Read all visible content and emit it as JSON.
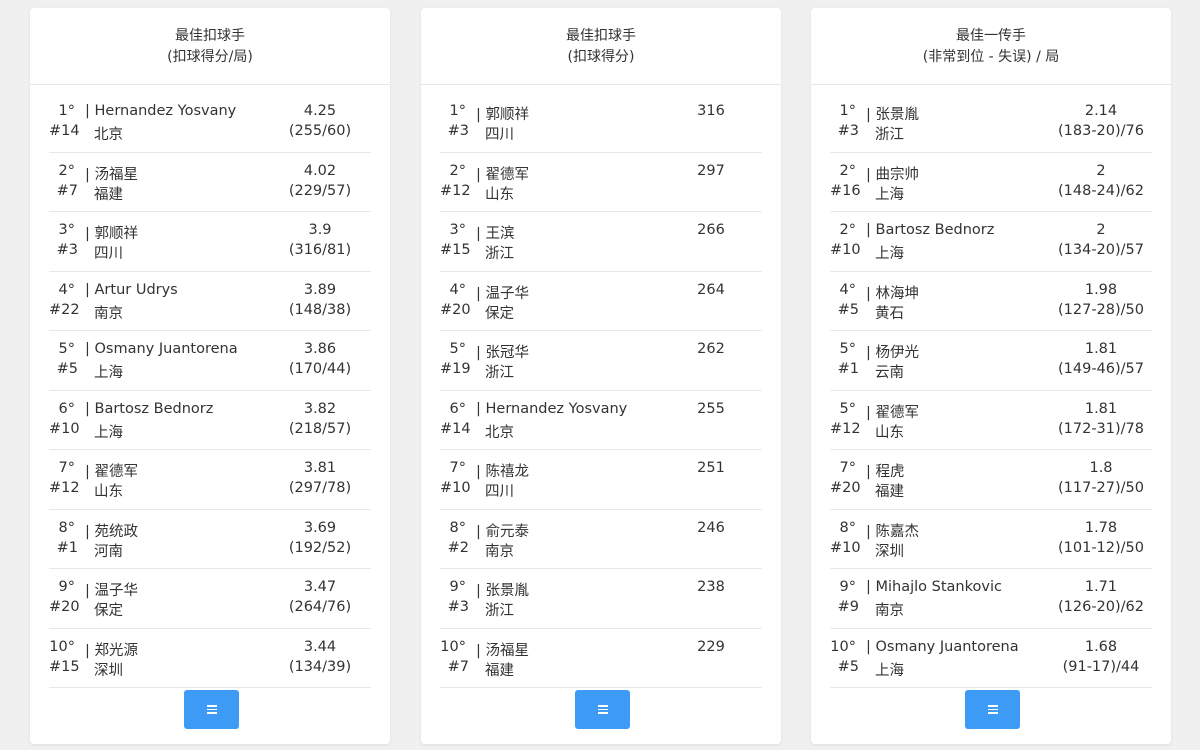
{
  "cards": [
    {
      "title_line1": "最佳扣球手",
      "title_line2": "(扣球得分/局)",
      "rows": [
        {
          "rank": "1°",
          "number": "#14",
          "name": "Hernandez Yosvany",
          "team": "北京",
          "value": "4.25",
          "detail": "(255/60)"
        },
        {
          "rank": "2°",
          "number": "#7",
          "name": "汤福星",
          "team": "福建",
          "value": "4.02",
          "detail": "(229/57)"
        },
        {
          "rank": "3°",
          "number": "#3",
          "name": "郭顺祥",
          "team": "四川",
          "value": "3.9",
          "detail": "(316/81)"
        },
        {
          "rank": "4°",
          "number": "#22",
          "name": "Artur Udrys",
          "team": "南京",
          "value": "3.89",
          "detail": "(148/38)"
        },
        {
          "rank": "5°",
          "number": "#5",
          "name": "Osmany Juantorena",
          "team": "上海",
          "value": "3.86",
          "detail": "(170/44)"
        },
        {
          "rank": "6°",
          "number": "#10",
          "name": "Bartosz Bednorz",
          "team": "上海",
          "value": "3.82",
          "detail": "(218/57)"
        },
        {
          "rank": "7°",
          "number": "#12",
          "name": "翟德军",
          "team": "山东",
          "value": "3.81",
          "detail": "(297/78)"
        },
        {
          "rank": "8°",
          "number": "#1",
          "name": "苑统政",
          "team": "河南",
          "value": "3.69",
          "detail": "(192/52)"
        },
        {
          "rank": "9°",
          "number": "#20",
          "name": "温子华",
          "team": "保定",
          "value": "3.47",
          "detail": "(264/76)"
        },
        {
          "rank": "10°",
          "number": "#15",
          "name": "郑光源",
          "team": "深圳",
          "value": "3.44",
          "detail": "(134/39)"
        }
      ]
    },
    {
      "title_line1": "最佳扣球手",
      "title_line2": "(扣球得分)",
      "rows": [
        {
          "rank": "1°",
          "number": "#3",
          "name": "郭顺祥",
          "team": "四川",
          "value": "316",
          "detail": ""
        },
        {
          "rank": "2°",
          "number": "#12",
          "name": "翟德军",
          "team": "山东",
          "value": "297",
          "detail": ""
        },
        {
          "rank": "3°",
          "number": "#15",
          "name": "王滨",
          "team": "浙江",
          "value": "266",
          "detail": ""
        },
        {
          "rank": "4°",
          "number": "#20",
          "name": "温子华",
          "team": "保定",
          "value": "264",
          "detail": ""
        },
        {
          "rank": "5°",
          "number": "#19",
          "name": "张冠华",
          "team": "浙江",
          "value": "262",
          "detail": ""
        },
        {
          "rank": "6°",
          "number": "#14",
          "name": "Hernandez Yosvany",
          "team": "北京",
          "value": "255",
          "detail": ""
        },
        {
          "rank": "7°",
          "number": "#10",
          "name": "陈禧龙",
          "team": "四川",
          "value": "251",
          "detail": ""
        },
        {
          "rank": "8°",
          "number": "#2",
          "name": "俞元泰",
          "team": "南京",
          "value": "246",
          "detail": ""
        },
        {
          "rank": "9°",
          "number": "#3",
          "name": "张景胤",
          "team": "浙江",
          "value": "238",
          "detail": ""
        },
        {
          "rank": "10°",
          "number": "#7",
          "name": "汤福星",
          "team": "福建",
          "value": "229",
          "detail": ""
        }
      ]
    },
    {
      "title_line1": "最佳一传手",
      "title_line2": "(非常到位 - 失误) / 局",
      "rows": [
        {
          "rank": "1°",
          "number": "#3",
          "name": "张景胤",
          "team": "浙江",
          "value": "2.14",
          "detail": "(183-20)/76"
        },
        {
          "rank": "2°",
          "number": "#16",
          "name": "曲宗帅",
          "team": "上海",
          "value": "2",
          "detail": "(148-24)/62"
        },
        {
          "rank": "2°",
          "number": "#10",
          "name": "Bartosz Bednorz",
          "team": "上海",
          "value": "2",
          "detail": "(134-20)/57"
        },
        {
          "rank": "4°",
          "number": "#5",
          "name": "林海坤",
          "team": "黄石",
          "value": "1.98",
          "detail": "(127-28)/50"
        },
        {
          "rank": "5°",
          "number": "#1",
          "name": "杨伊光",
          "team": "云南",
          "value": "1.81",
          "detail": "(149-46)/57"
        },
        {
          "rank": "5°",
          "number": "#12",
          "name": "翟德军",
          "team": "山东",
          "value": "1.81",
          "detail": "(172-31)/78"
        },
        {
          "rank": "7°",
          "number": "#20",
          "name": "程虎",
          "team": "福建",
          "value": "1.8",
          "detail": "(117-27)/50"
        },
        {
          "rank": "8°",
          "number": "#10",
          "name": "陈嘉杰",
          "team": "深圳",
          "value": "1.78",
          "detail": "(101-12)/50"
        },
        {
          "rank": "9°",
          "number": "#9",
          "name": "Mihajlo Stankovic",
          "team": "南京",
          "value": "1.71",
          "detail": "(126-20)/62"
        },
        {
          "rank": "10°",
          "number": "#5",
          "name": "Osmany Juantorena",
          "team": "上海",
          "value": "1.68",
          "detail": "(91-17)/44"
        }
      ]
    }
  ],
  "icons": {
    "menu_button": "menu-icon"
  },
  "colors": {
    "button": "#3d9bf5",
    "background": "#f0f0f0",
    "card": "#ffffff"
  }
}
